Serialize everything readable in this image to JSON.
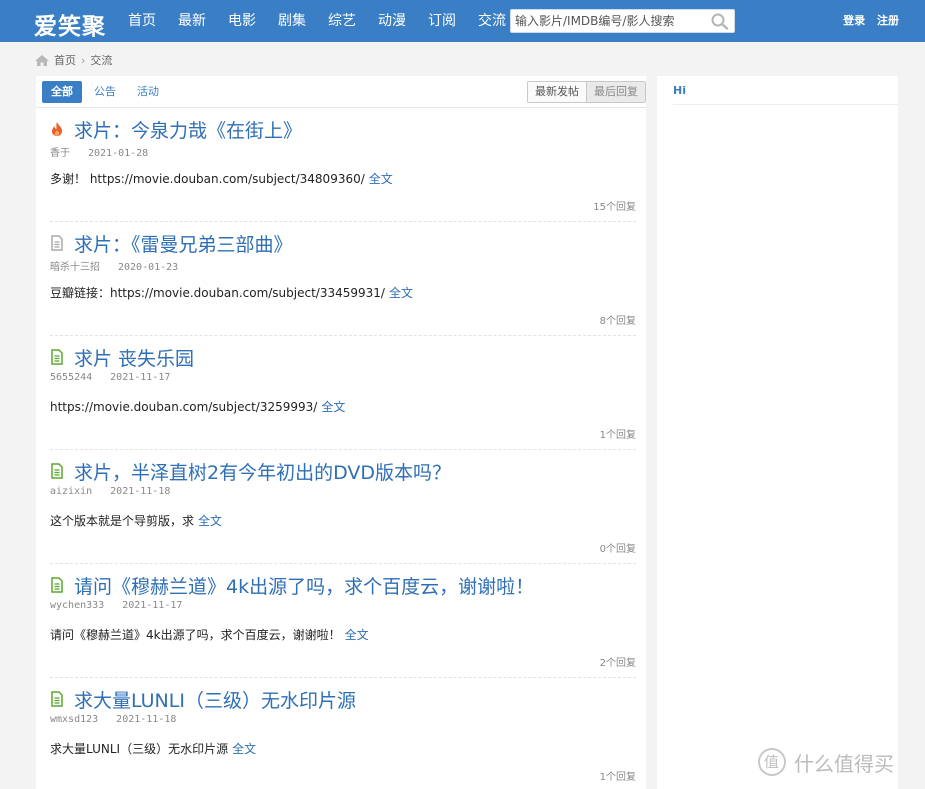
{
  "header": {
    "logo": "爱笑聚",
    "nav": [
      "首页",
      "最新",
      "电影",
      "剧集",
      "综艺",
      "动漫",
      "订阅",
      "交流"
    ],
    "search_placeholder": "输入影片/IMDB编号/影人搜索",
    "login": "登录",
    "register": "注册"
  },
  "breadcrumb": {
    "home": "首页",
    "current": "交流"
  },
  "tabs": [
    "全部",
    "公告",
    "活动"
  ],
  "sort": {
    "newest": "最新发帖",
    "last_reply": "最后回复"
  },
  "posts": [
    {
      "icon": "fire-icon",
      "title": "求片：今泉力哉《在街上》",
      "author": "香于",
      "date": "2021-01-28",
      "summary": "多谢！ https://movie.douban.com/subject/34809360/",
      "full": "全文",
      "replies": "15个回复"
    },
    {
      "icon": "document-gray-icon",
      "title": "求片：《雷曼兄弟三部曲》",
      "author": "暗杀十三招",
      "date": "2020-01-23",
      "summary": "豆瓣链接：https://movie.douban.com/subject/33459931/",
      "full": "全文",
      "replies": "8个回复"
    },
    {
      "icon": "document-green-icon",
      "title": "求片 丧失乐园",
      "author": "5655244",
      "date": "2021-11-17",
      "summary": "https://movie.douban.com/subject/3259993/",
      "full": "全文",
      "replies": "1个回复"
    },
    {
      "icon": "document-green-icon",
      "title": "求片，半泽直树2有今年初出的DVD版本吗？",
      "author": "aizixin",
      "date": "2021-11-18",
      "summary": "这个版本就是个导剪版，求",
      "full": "全文",
      "replies": "0个回复"
    },
    {
      "icon": "document-green-icon",
      "title": "请问《穆赫兰道》4k出源了吗，求个百度云，谢谢啦！",
      "author": "wychen333",
      "date": "2021-11-17",
      "summary": "请问《穆赫兰道》4k出源了吗，求个百度云，谢谢啦！",
      "full": "全文",
      "replies": "2个回复"
    },
    {
      "icon": "document-green-icon",
      "title": "求大量LUNLI（三级）无水印片源",
      "author": "wmxsd123",
      "date": "2021-11-18",
      "summary": "求大量LUNLI（三级）无水印片源",
      "full": "全文",
      "replies": "1个回复"
    }
  ],
  "sidebar": {
    "title": "Hi"
  },
  "watermark": {
    "text": "什么值得买"
  },
  "colors": {
    "header": "#3a7fc5",
    "link": "#2f6fb6",
    "fire": "#e8612c",
    "doc_green": "#5aa832",
    "doc_gray": "#aaaaaa"
  }
}
